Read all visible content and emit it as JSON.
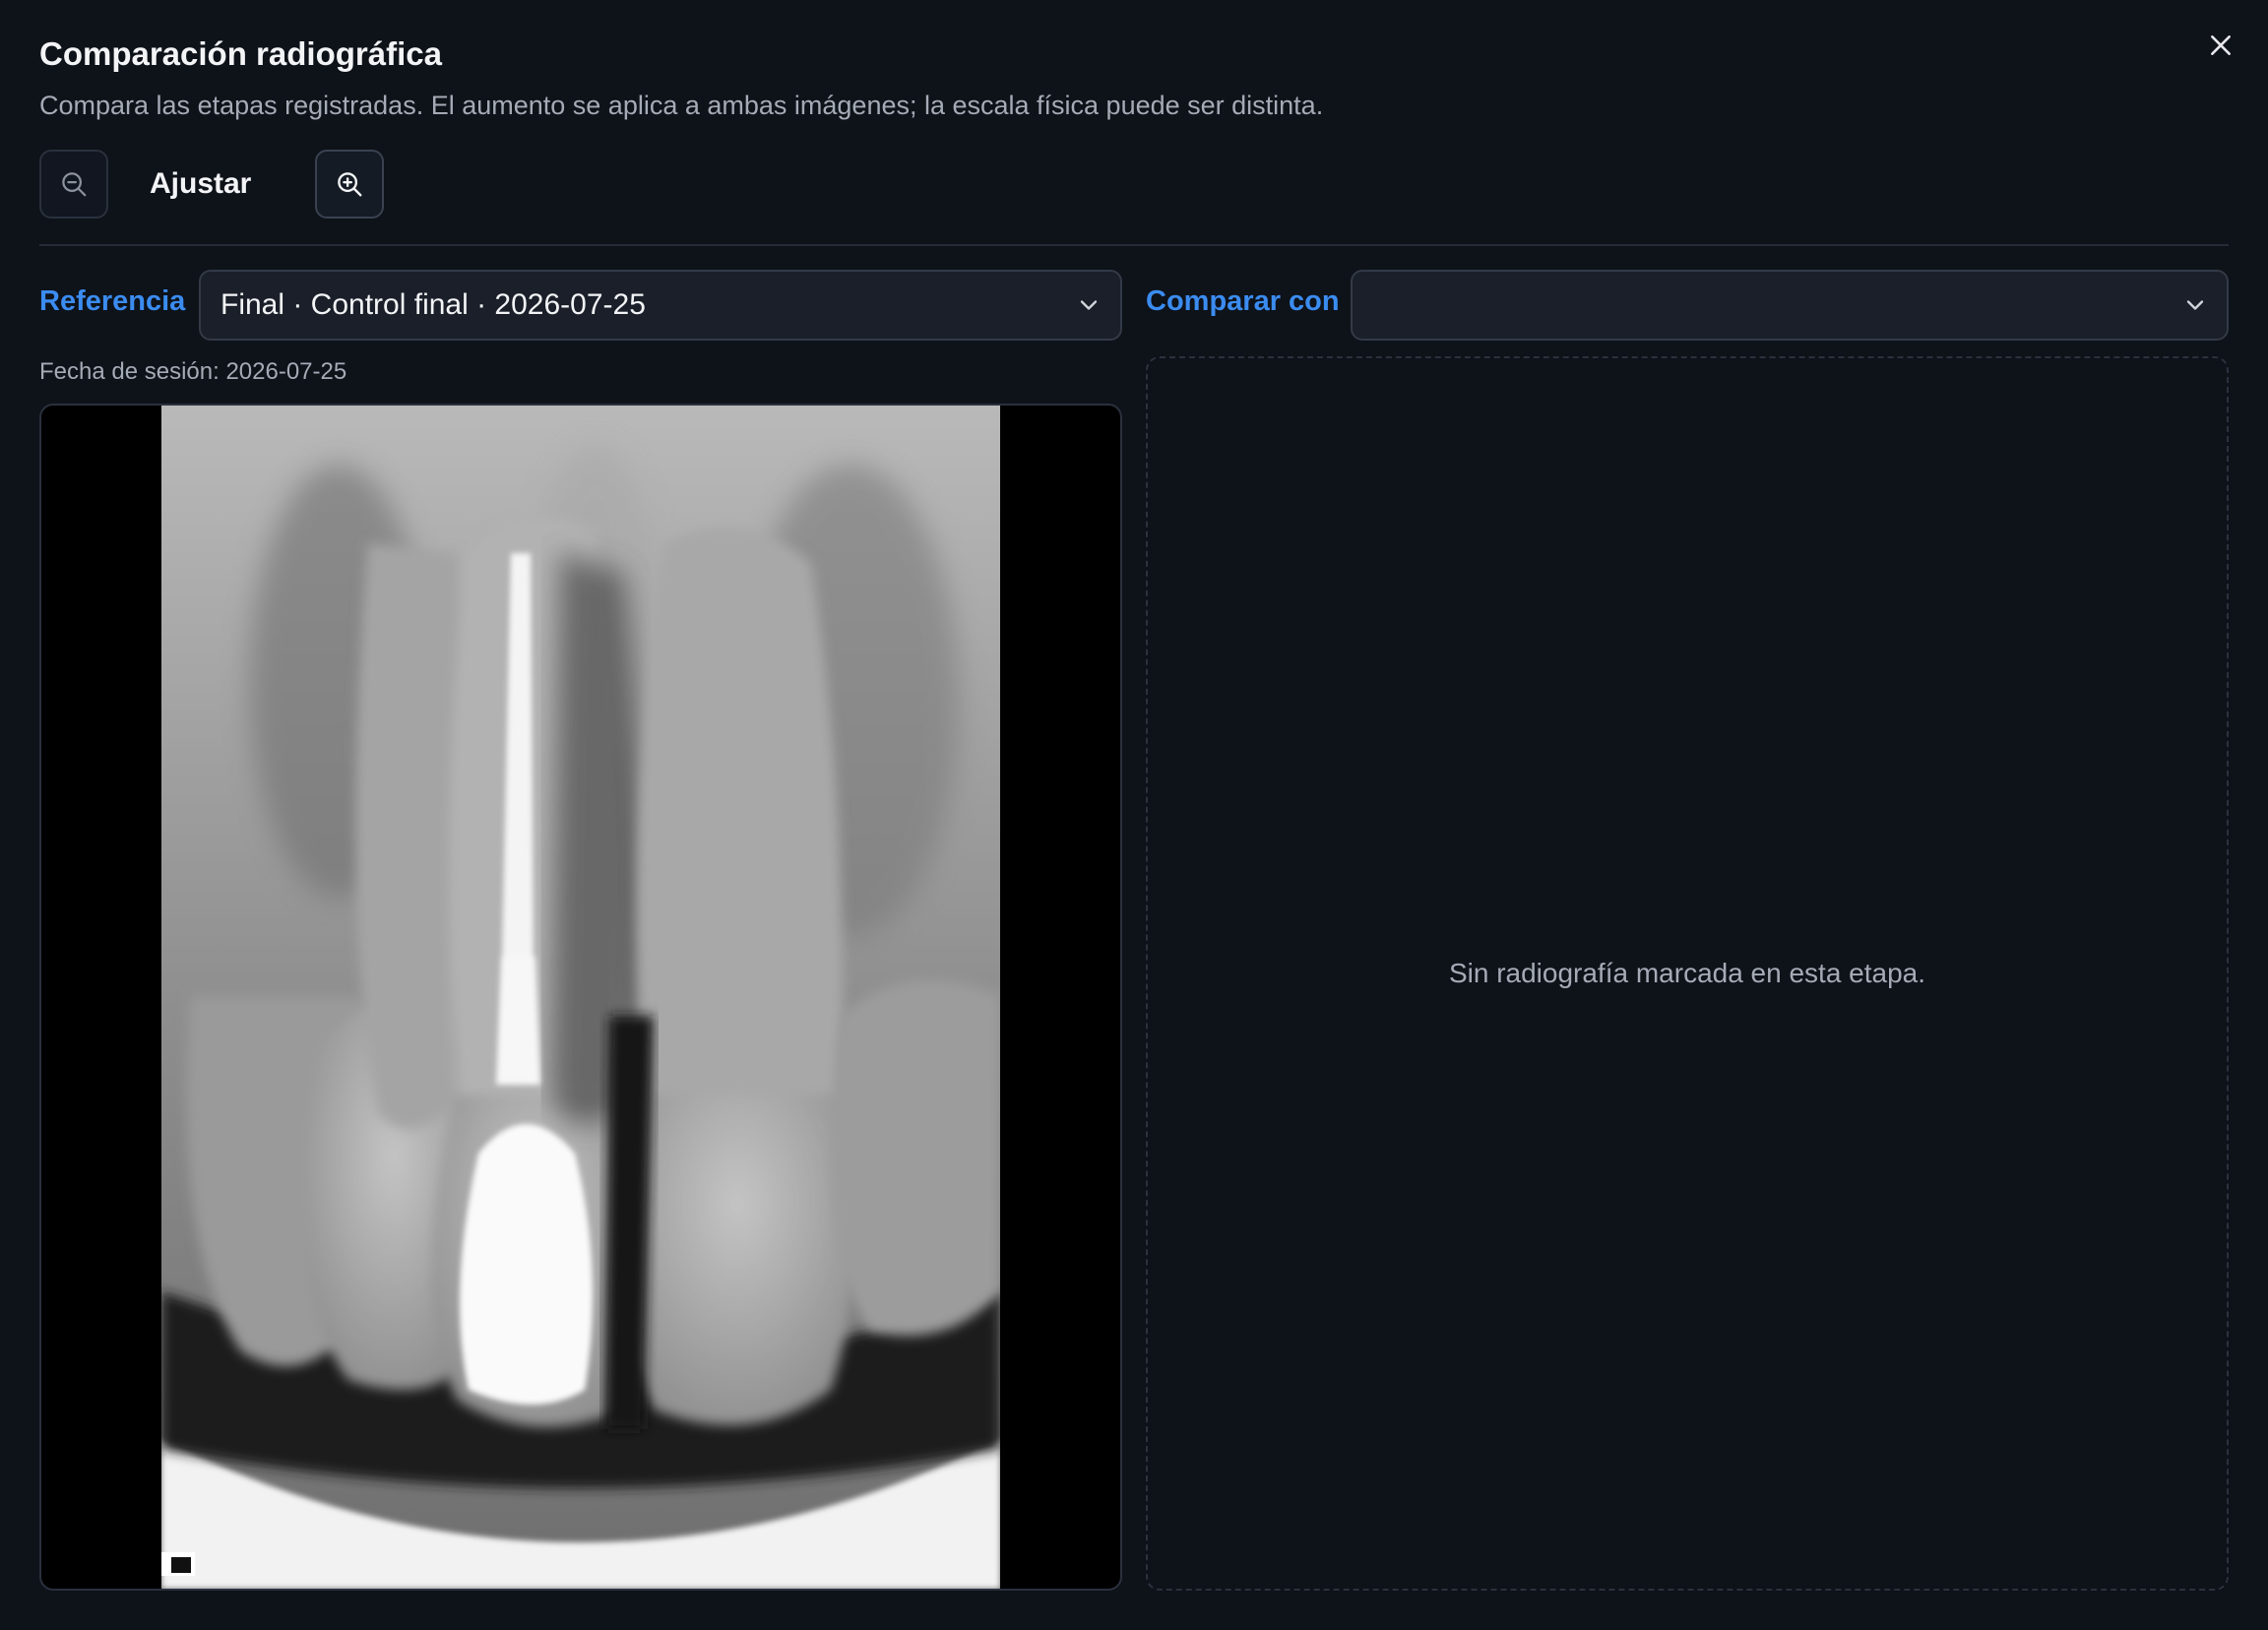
{
  "dialog": {
    "title": "Comparación radiográfica",
    "subtitle": "Compara las etapas registradas. El aumento se aplica a ambas imágenes; la escala física puede ser distinta.",
    "close_icon": "close-icon"
  },
  "toolbar": {
    "zoom_out_icon": "zoom-out-icon",
    "fit_label": "Ajustar",
    "zoom_in_icon": "zoom-in-icon"
  },
  "reference": {
    "label": "Referencia",
    "selected": "Final · Control final · 2026-07-25",
    "session_date": "Fecha de sesión: 2026-07-25"
  },
  "compare": {
    "label": "Comparar con",
    "selected": "",
    "empty_message": "Sin radiografía marcada en esta etapa."
  },
  "colors": {
    "background": "#0e1219",
    "accent": "#3b8cf0",
    "select_bg": "#1a1f29",
    "border": "#2a313d"
  }
}
